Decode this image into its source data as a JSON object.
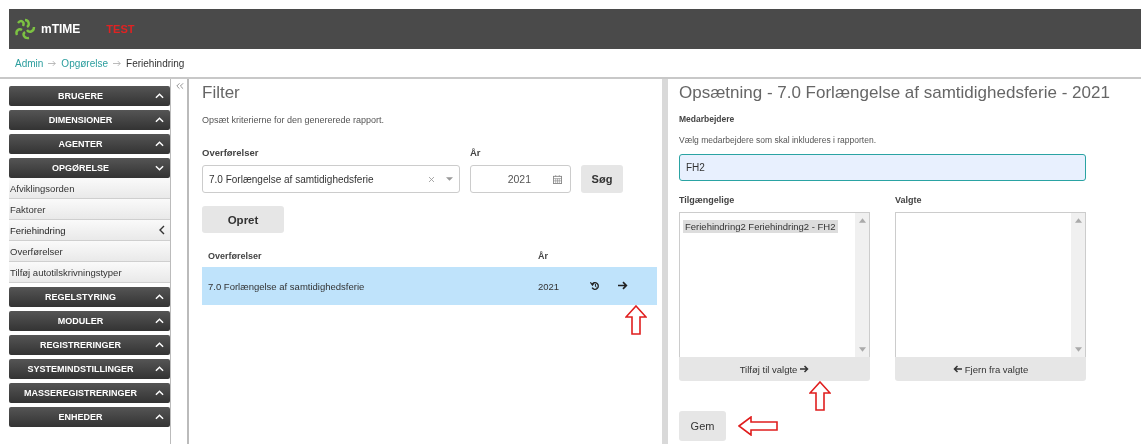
{
  "header": {
    "logo": "mTIME",
    "environment": "TEST"
  },
  "breadcrumb": [
    "Admin",
    "Opgørelse",
    "Feriehindring"
  ],
  "sidebar": {
    "groups": [
      {
        "label": "BRUGERE",
        "expanded": false
      },
      {
        "label": "DIMENSIONER",
        "expanded": false
      },
      {
        "label": "AGENTER",
        "expanded": false
      },
      {
        "label": "OPGØRELSE",
        "expanded": true,
        "children": [
          {
            "label": "Afviklingsorden",
            "selected": false
          },
          {
            "label": "Faktorer",
            "selected": false
          },
          {
            "label": "Feriehindring",
            "selected": true
          },
          {
            "label": "Overførelser",
            "selected": false
          },
          {
            "label": "Tilføj autotilskrivningstyper",
            "selected": false
          }
        ]
      },
      {
        "label": "REGELSTYRING",
        "expanded": false
      },
      {
        "label": "MODULER",
        "expanded": false
      },
      {
        "label": "REGISTRERINGER",
        "expanded": false
      },
      {
        "label": "SYSTEMINDSTILLINGER",
        "expanded": false
      },
      {
        "label": "MASSEREGISTRERINGER",
        "expanded": false
      },
      {
        "label": "ENHEDER",
        "expanded": false
      }
    ]
  },
  "filter": {
    "title": "Filter",
    "description": "Opsæt kriterierne for den genererede rapport.",
    "transfer_label": "Overførelser",
    "transfer_value": "7.0 Forlængelse af samtidighedsferie",
    "year_label": "År",
    "year_value": "2021",
    "search_button": "Søg",
    "create_button": "Opret",
    "table": {
      "columns": [
        "Overførelser",
        "År"
      ],
      "rows": [
        {
          "cells": [
            "7.0 Forlængelse af samtidighedsferie",
            "2021"
          ],
          "selected": true
        }
      ]
    }
  },
  "setup": {
    "title": "Opsætning - 7.0 Forlængelse af samtidighedsferie - 2021",
    "section": "Medarbejdere",
    "description": "Vælg medarbejdere som skal inkluderes i rapporten.",
    "search_value": "FH2",
    "available_label": "Tilgængelige",
    "available_items": [
      {
        "label": "Feriehindring2 Feriehindring2 - FH2",
        "selected": true
      }
    ],
    "chosen_label": "Valgte",
    "add_button": "Tilføj til valgte",
    "remove_button": "Fjern fra valgte",
    "save_button": "Gem"
  }
}
